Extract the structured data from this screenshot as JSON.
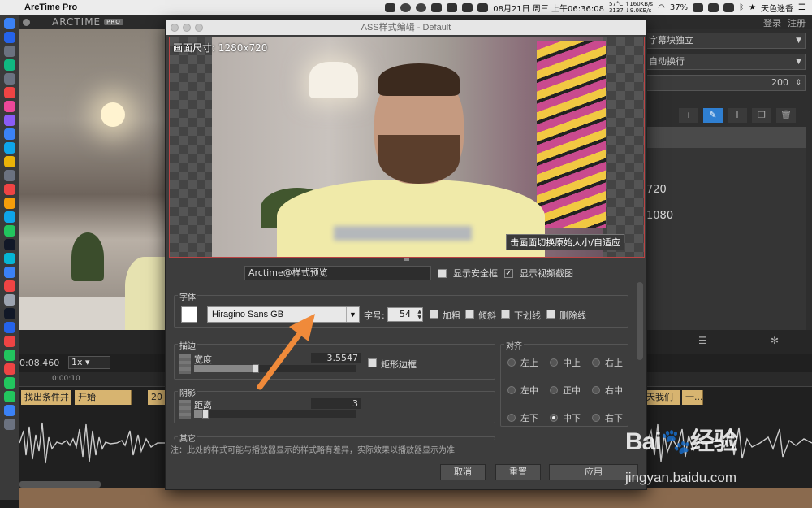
{
  "menubar": {
    "app_name": "ArcTime Pro",
    "network_up": "57°C ↑160KB/s",
    "network_down": "3137 ↓9.0KB/s",
    "datetime": "08月21日 周三 上午06:36:08",
    "battery": "37%",
    "user": "天色迷香"
  },
  "app": {
    "logo_text": "ARCTIME",
    "logo_badge": "PRO",
    "login": "登录",
    "register": "注册"
  },
  "right_panel": {
    "combo1": "字幕块独立",
    "combo2": "自动换行",
    "number_field": "200",
    "val1": "720",
    "val2": "1080"
  },
  "timeline": {
    "current_time": "0:08.460",
    "speed": "1x",
    "ruler_mark": "0:00:10",
    "clips": [
      "找出条件并",
      "开始",
      "20",
      "天我们",
      "一..."
    ]
  },
  "dialog": {
    "title": "ASS样式编辑 - Default",
    "preview_size": "画面尺寸: 1280x720",
    "preview_tip": "击画面切换原始大小/自适应",
    "preview_text_input": "Arctime@样式预览",
    "show_safe_frame": "显示安全框",
    "show_video_frame": "显示视频截图",
    "font_group": "字体",
    "font_name": "Hiragino Sans GB",
    "font_size_label": "字号:",
    "font_size": "54",
    "bold": "加粗",
    "italic": "倾斜",
    "underline": "下划线",
    "strikeout": "删除线",
    "outline_group": "描边",
    "outline_width_label": "宽度",
    "outline_width": "3.5547",
    "outline_width_fraction": 0.38,
    "rect_border": "矩形边框",
    "shadow_group": "阴影",
    "shadow_distance_label": "距离",
    "shadow_distance": "3",
    "shadow_distance_fraction": 0.07,
    "cut_group": "其它",
    "align_group": "对齐",
    "align_options": [
      "左上",
      "中上",
      "右上",
      "左中",
      "正中",
      "右中",
      "左下",
      "中下",
      "右下"
    ],
    "note": "注：此处的样式可能与播放器显示的样式略有差异，实际效果以播放器显示为准",
    "cancel": "取消",
    "reset": "重置",
    "apply": "应用"
  },
  "watermark": {
    "brand": "Bai",
    "brand2": "经验",
    "url": "jingyan.baidu.com"
  },
  "colors": {
    "accent": "#f08a3a",
    "preview_border": "#b44444",
    "active_tool": "#2f7fd1"
  }
}
